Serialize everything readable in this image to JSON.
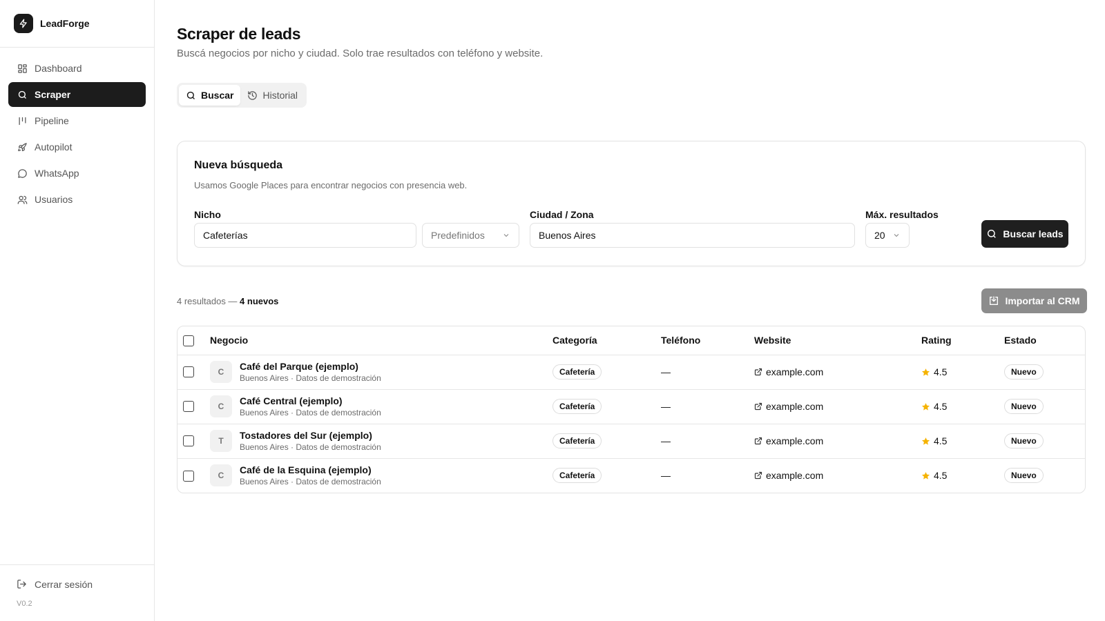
{
  "brand": {
    "name": "LeadForge"
  },
  "sidebar": {
    "items": [
      {
        "label": "Dashboard",
        "icon": "dashboard-icon"
      },
      {
        "label": "Scraper",
        "icon": "search-icon",
        "active": true
      },
      {
        "label": "Pipeline",
        "icon": "pipeline-icon"
      },
      {
        "label": "Autopilot",
        "icon": "rocket-icon"
      },
      {
        "label": "WhatsApp",
        "icon": "chat-bubble-icon"
      },
      {
        "label": "Usuarios",
        "icon": "users-icon"
      }
    ],
    "logout_label": "Cerrar sesión",
    "version": "V0.2"
  },
  "page": {
    "title": "Scraper de leads",
    "subtitle": "Buscá negocios por nicho y ciudad. Solo trae resultados con teléfono y website."
  },
  "tabs": [
    {
      "label": "Buscar",
      "active": true
    },
    {
      "label": "Historial",
      "active": false
    }
  ],
  "search_card": {
    "title": "Nueva búsqueda",
    "description": "Usamos Google Places para encontrar negocios con presencia web.",
    "niche_label": "Nicho",
    "niche_value": "Cafeterías",
    "presets_label": "Predefinidos",
    "city_label": "Ciudad / Zona",
    "city_value": "Buenos Aires",
    "max_label": "Máx. resultados",
    "max_value": "20",
    "submit_label": "Buscar leads"
  },
  "results": {
    "count_text": "4 resultados — ",
    "new_text": "4 nuevos",
    "import_label": "Importar al CRM",
    "columns": [
      "Negocio",
      "Categoría",
      "Teléfono",
      "Website",
      "Rating",
      "Estado"
    ],
    "rows": [
      {
        "initial": "C",
        "name": "Café del Parque (ejemplo)",
        "sub": "Buenos Aires · Datos de demostración",
        "category": "Cafetería",
        "phone": "—",
        "website": "example.com",
        "rating": "4.5",
        "status": "Nuevo"
      },
      {
        "initial": "C",
        "name": "Café Central (ejemplo)",
        "sub": "Buenos Aires · Datos de demostración",
        "category": "Cafetería",
        "phone": "—",
        "website": "example.com",
        "rating": "4.5",
        "status": "Nuevo"
      },
      {
        "initial": "T",
        "name": "Tostadores del Sur (ejemplo)",
        "sub": "Buenos Aires · Datos de demostración",
        "category": "Cafetería",
        "phone": "—",
        "website": "example.com",
        "rating": "4.5",
        "status": "Nuevo"
      },
      {
        "initial": "C",
        "name": "Café de la Esquina (ejemplo)",
        "sub": "Buenos Aires · Datos de demostración",
        "category": "Cafetería",
        "phone": "—",
        "website": "example.com",
        "rating": "4.5",
        "status": "Nuevo"
      }
    ]
  },
  "colors": {
    "primary": "#1f1f1f",
    "star": "#f5b301",
    "import_button": "#8c8c8c"
  }
}
